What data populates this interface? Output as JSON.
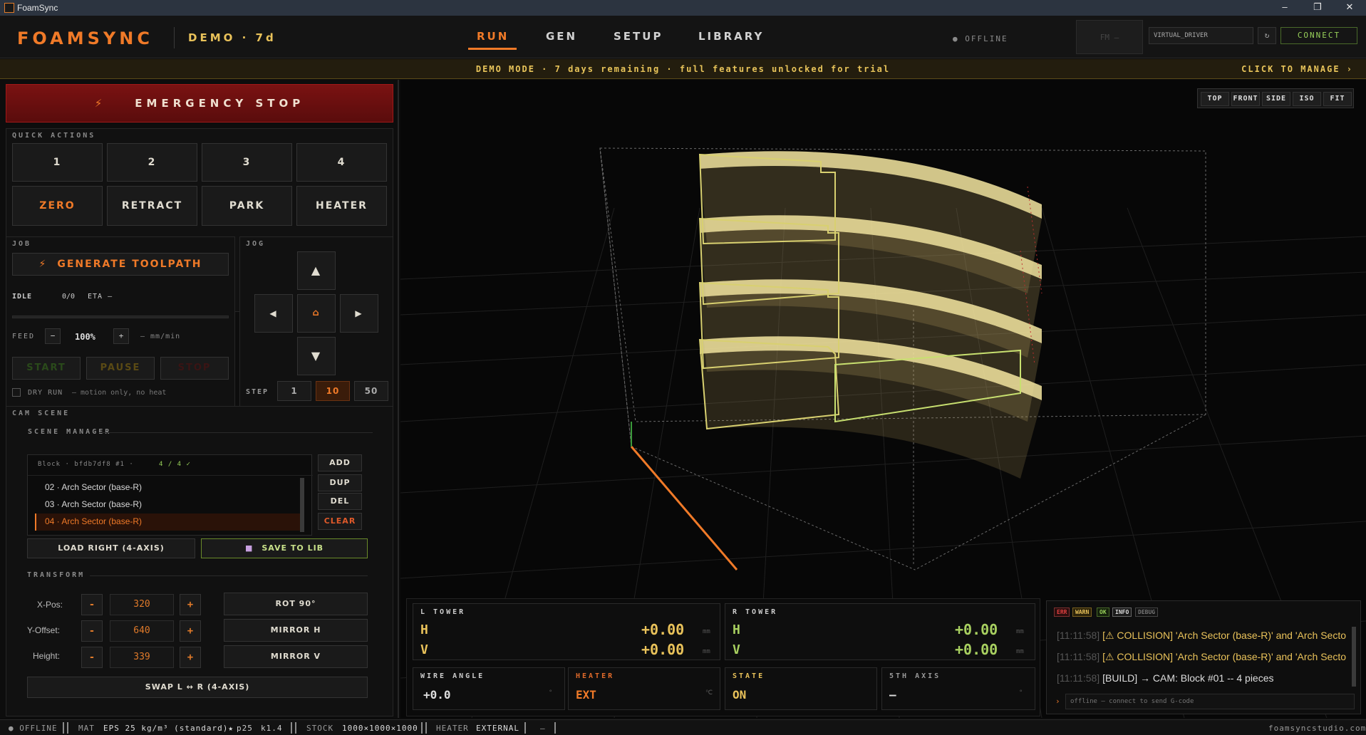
{
  "window": {
    "title": "FoamSync"
  },
  "header": {
    "brand": "FOAMSYNC",
    "demo": "DEMO · 7d",
    "tabs": [
      {
        "label": "RUN"
      },
      {
        "label": "GEN"
      },
      {
        "label": "SETUP"
      },
      {
        "label": "LIBRARY"
      }
    ],
    "status": "● OFFLINE",
    "fm_box": "FM —",
    "driver": "VIRTUAL_DRIVER",
    "refresh": "↻",
    "connect": "CONNECT"
  },
  "banner": {
    "message": "DEMO MODE · 7 days remaining · full features unlocked for trial",
    "manage": "CLICK TO MANAGE ›"
  },
  "left": {
    "estop": "EMERGENCY STOP",
    "estop_icon": "⚡",
    "quick_actions": {
      "label": "QUICK ACTIONS",
      "slots": [
        "1",
        "2",
        "3",
        "4"
      ],
      "actions": [
        "ZERO",
        "RETRACT",
        "PARK",
        "HEATER"
      ]
    },
    "job": {
      "label": "JOB",
      "generate": "GENERATE TOOLPATH",
      "state": "IDLE",
      "progress": "0/0",
      "eta": "ETA —",
      "feed_label": "FEED",
      "feed_minus": "−",
      "feed_value": "100%",
      "feed_plus": "+",
      "feed_unit": "— mm/min",
      "start": "START",
      "pause": "PAUSE",
      "stop": "STOP",
      "dry_run": "DRY RUN",
      "dry_run_hint": "— motion only, no heat"
    },
    "jog": {
      "label": "JOG",
      "up": "▲",
      "down": "▼",
      "left": "◀",
      "right": "▶",
      "home": "⌂",
      "step_label": "STEP",
      "steps": [
        "1",
        "10",
        "50"
      ]
    },
    "cam": {
      "label": "CAM SCENE",
      "scene_manager": "SCENE MANAGER",
      "block_header": "Block · bfdb7df8 #1 ·",
      "block_count": "4 / 4 ✓",
      "items": [
        {
          "label": "02 · Arch Sector (base-R)"
        },
        {
          "label": "03 · Arch Sector (base-R)"
        },
        {
          "label": "04 · Arch Sector (base-R)"
        }
      ],
      "buttons": [
        "ADD",
        "DUP",
        "DEL",
        "CLEAR"
      ],
      "load_right": "LOAD RIGHT (4-AXIS)",
      "save_to_lib": "SAVE TO LIB",
      "transform": "TRANSFORM",
      "x_pos_label": "X-Pos:",
      "x_pos": "320",
      "y_off_label": "Y-Offset:",
      "y_off": "640",
      "height_label": "Height:",
      "height": "339",
      "minus": "-",
      "plus": "+",
      "rot": "ROT 90°",
      "mirror_h": "MIRROR H",
      "mirror_v": "MIRROR V",
      "swap": "SWAP L ↔ R (4-AXIS)"
    }
  },
  "viewport": {
    "views": [
      "TOP",
      "FRONT",
      "SIDE",
      "ISO",
      "FIT"
    ]
  },
  "dro": {
    "l_tower": "L TOWER",
    "r_tower": "R TOWER",
    "h": "H",
    "v": "V",
    "l_h": "+0.00",
    "l_v": "+0.00",
    "r_h": "+0.00",
    "r_v": "+0.00",
    "unit": "mm",
    "wire_angle_label": "WIRE ANGLE",
    "wire_angle": "+0.0",
    "wire_angle_unit": "°",
    "heater_label": "HEATER",
    "heater": "EXT",
    "heater_unit": "℃",
    "state_label": "STATE",
    "state": "ON",
    "axis5_label": "5TH AXIS",
    "axis5": "—",
    "axis5_unit": "°"
  },
  "console": {
    "tags": [
      "ERR",
      "WARN",
      "OK",
      "INFO",
      "DEBUG"
    ],
    "lines": [
      {
        "time": "[11:11:58]",
        "text": "[⚠ COLLISION] 'Arch Sector (base-R)' and 'Arch Sector (base-R)'"
      },
      {
        "time": "[11:11:58]",
        "text": "[⚠ COLLISION] 'Arch Sector (base-R)' and 'Arch Sector (base-R)'"
      },
      {
        "time": "[11:11:58]",
        "text": "[BUILD] → CAM: Block #01 -- 4 pieces"
      }
    ],
    "prompt": "›",
    "placeholder": "offline — connect to send G-code"
  },
  "statusbar": {
    "offline": "● OFFLINE",
    "mat_label": "MAT",
    "mat": "EPS 25 kg/m³ (standard)★",
    "p": "p25",
    "k": "k1.4",
    "stock_label": "STOCK",
    "stock": "1000×1000×1000",
    "heater_label": "HEATER",
    "heater": "EXTERNAL",
    "dash": "—",
    "site": "foamsyncstudio.com"
  }
}
